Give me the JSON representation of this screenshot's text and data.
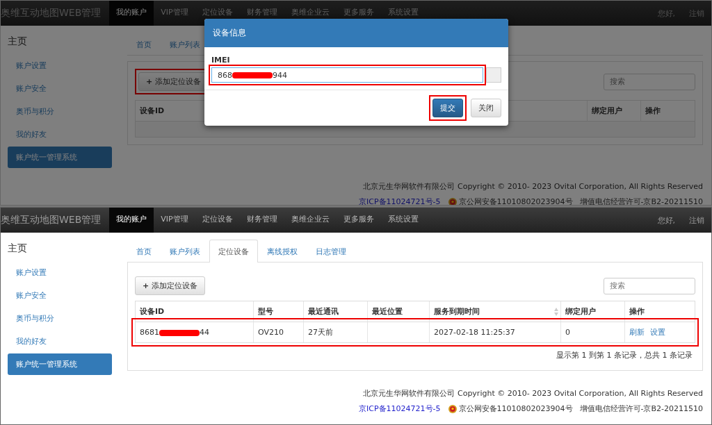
{
  "screens": [
    {
      "navbar": {
        "brand": "奥维互动地图WEB管理",
        "items": [
          {
            "label": "我的账户",
            "selected": true
          },
          {
            "label": "VIP管理",
            "selected": false
          },
          {
            "label": "定位设备",
            "selected": false
          },
          {
            "label": "财务管理",
            "selected": false
          },
          {
            "label": "奥维企业云",
            "selected": false
          },
          {
            "label": "更多服务",
            "selected": false
          },
          {
            "label": "系统设置",
            "selected": false
          }
        ],
        "greeting": "您好,",
        "logout": "注销"
      },
      "sidebar": {
        "title": "主页",
        "items": [
          {
            "label": "账户设置",
            "selected": false
          },
          {
            "label": "账户安全",
            "selected": false
          },
          {
            "label": "奥币与积分",
            "selected": false
          },
          {
            "label": "我的好友",
            "selected": false
          },
          {
            "label": "账户统一管理系统",
            "selected": true
          }
        ]
      },
      "tabs": [
        {
          "label": "首页",
          "selected": false
        },
        {
          "label": "账户列表",
          "selected": false
        }
      ],
      "add_button": {
        "icon": "+",
        "label": "添加定位设备",
        "highlighted": true
      },
      "search": {
        "placeholder": "搜索"
      },
      "table": {
        "columns": [
          {
            "label": "设备ID",
            "sortable": false
          },
          {
            "label": "绑定用户",
            "sortable": false
          },
          {
            "label": "操作",
            "sortable": false
          }
        ],
        "empty_row": true
      },
      "footer": {
        "copyright": "北京元生华网软件有限公司 Copyright © 2010- 2023 Ovital Corporation, All Rights Reserved",
        "icp": "京ICP备11024721号-5",
        "police": "京公网安备11010802023904号",
        "license": "增值电信经营许可-京B2-20211510"
      },
      "modal": {
        "title": "设备信息",
        "field_label": "IMEI",
        "value_prefix": "868",
        "value_suffix": "944",
        "field_highlighted": true,
        "submit": "提交",
        "submit_highlighted": true,
        "close": "关闭"
      }
    },
    {
      "navbar": {
        "brand": "奥维互动地图WEB管理",
        "items": [
          {
            "label": "我的账户",
            "selected": true
          },
          {
            "label": "VIP管理",
            "selected": false
          },
          {
            "label": "定位设备",
            "selected": false
          },
          {
            "label": "财务管理",
            "selected": false
          },
          {
            "label": "奥维企业云",
            "selected": false
          },
          {
            "label": "更多服务",
            "selected": false
          },
          {
            "label": "系统设置",
            "selected": false
          }
        ],
        "greeting": "您好,",
        "logout": "注销"
      },
      "sidebar": {
        "title": "主页",
        "items": [
          {
            "label": "账户设置",
            "selected": false
          },
          {
            "label": "账户安全",
            "selected": false
          },
          {
            "label": "奥币与积分",
            "selected": false
          },
          {
            "label": "我的好友",
            "selected": false
          },
          {
            "label": "账户统一管理系统",
            "selected": true
          }
        ]
      },
      "tabs": [
        {
          "label": "首页",
          "selected": false
        },
        {
          "label": "账户列表",
          "selected": false
        },
        {
          "label": "定位设备",
          "selected": true
        },
        {
          "label": "离线授权",
          "selected": false
        },
        {
          "label": "日志管理",
          "selected": false
        }
      ],
      "add_button": {
        "icon": "+",
        "label": "添加定位设备"
      },
      "search": {
        "placeholder": "搜索"
      },
      "table": {
        "columns": [
          {
            "label": "设备ID",
            "sortable": false
          },
          {
            "label": "型号",
            "sortable": false
          },
          {
            "label": "最近通讯",
            "sortable": false
          },
          {
            "label": "最近位置",
            "sortable": false
          },
          {
            "label": "服务到期时间",
            "sortable": true
          },
          {
            "label": "绑定用户",
            "sortable": false
          },
          {
            "label": "操作",
            "sortable": false
          }
        ],
        "rows": [
          {
            "highlighted": true,
            "cells": [
              {
                "kind": "redacted",
                "prefix": "8681",
                "suffix": "44"
              },
              {
                "kind": "text",
                "text": "OV210"
              },
              {
                "kind": "text",
                "text": "27天前"
              },
              {
                "kind": "text",
                "text": ""
              },
              {
                "kind": "text",
                "text": "2027-02-18 11:25:37"
              },
              {
                "kind": "text",
                "text": "0"
              },
              {
                "kind": "actions",
                "links": [
                  "刷新",
                  "设置"
                ]
              }
            ]
          }
        ]
      },
      "pagination": "显示第 1 到第 1 条记录，总共 1 条记录",
      "footer": {
        "copyright": "北京元生华网软件有限公司 Copyright © 2010- 2023 Ovital Corporation, All Rights Reserved",
        "icp": "京ICP备11024721号-5",
        "police": "京公网安备11010802023904号",
        "license": "增值电信经营许可-京B2-20211510"
      }
    }
  ]
}
